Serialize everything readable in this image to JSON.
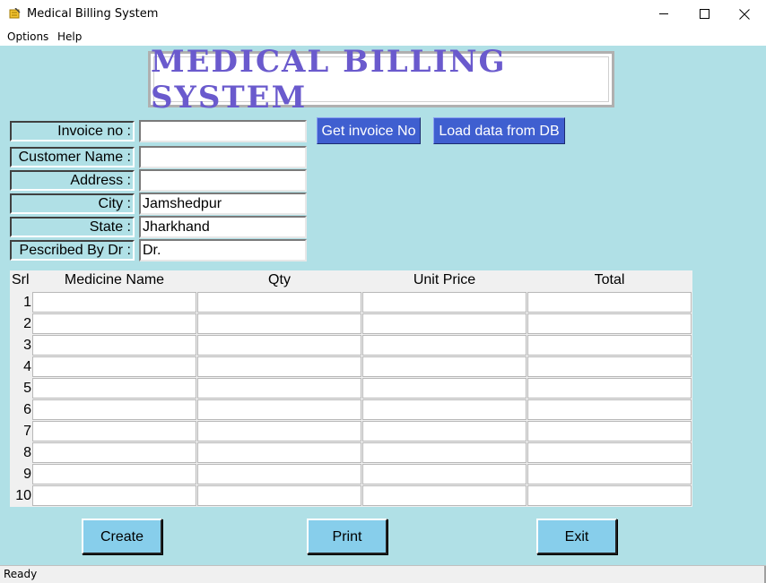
{
  "window": {
    "title": "Medical Billing System"
  },
  "menu": {
    "items": [
      "Options",
      "Help"
    ]
  },
  "banner": {
    "text": "MEDICAL BILLING SYSTEM"
  },
  "form": {
    "fields": [
      {
        "label": "Invoice no :",
        "value": ""
      },
      {
        "label": "Customer Name :",
        "value": ""
      },
      {
        "label": "Address :",
        "value": ""
      },
      {
        "label": "City :",
        "value": "Jamshedpur"
      },
      {
        "label": "State :",
        "value": "Jharkhand"
      },
      {
        "label": "Pescribed By Dr :",
        "value": "Dr."
      }
    ]
  },
  "actions_top": {
    "get_invoice": "Get invoice No",
    "load_data": "Load data from DB"
  },
  "table": {
    "columns": [
      "Srl",
      "Medicine Name",
      "Qty",
      "Unit Price",
      "Total"
    ],
    "rows": [
      "1",
      "2",
      "3",
      "4",
      "5",
      "6",
      "7",
      "8",
      "9",
      "10"
    ]
  },
  "actions_bottom": {
    "create": "Create",
    "print": "Print",
    "exit": "Exit"
  },
  "status": {
    "text": "Ready"
  },
  "colors": {
    "client_bg": "#b0e0e6",
    "banner_text": "#6a5acd",
    "blue_button": "#3f5fd0",
    "action_button": "#87ceeb"
  }
}
